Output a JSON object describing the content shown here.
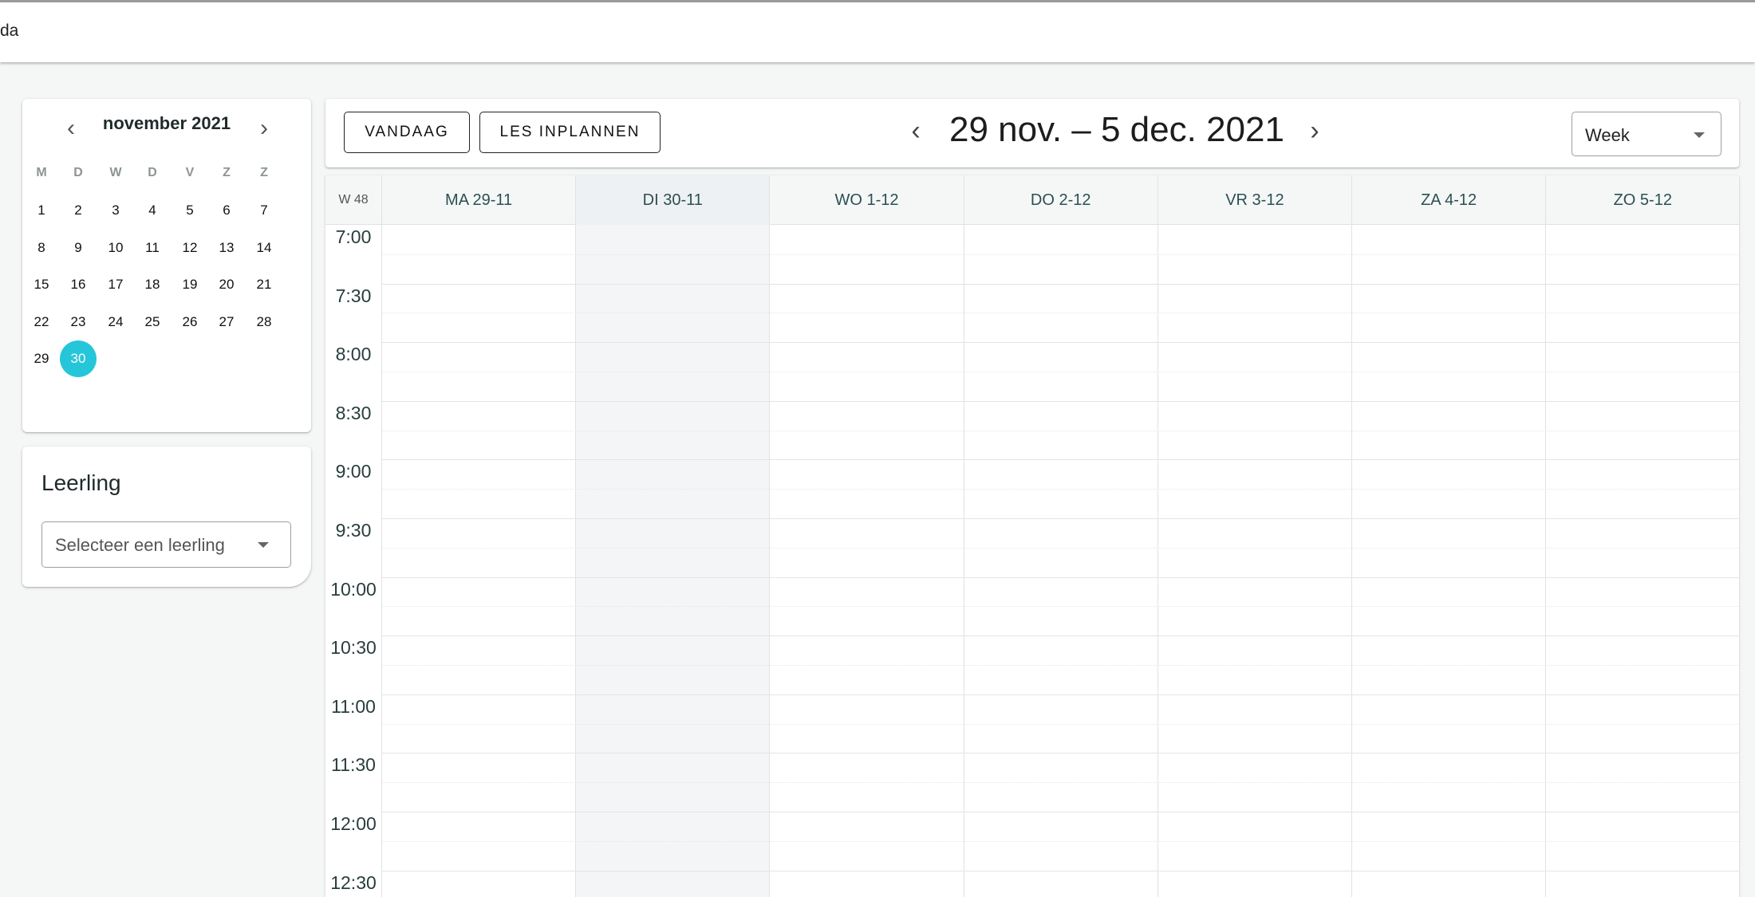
{
  "app": {
    "title": "da"
  },
  "mini_calendar": {
    "month_label": "november 2021",
    "prev_icon": "chevron-left-icon",
    "next_icon": "chevron-right-icon",
    "weekdays": [
      "M",
      "D",
      "W",
      "D",
      "V",
      "Z",
      "Z"
    ],
    "weeks": [
      [
        "1",
        "2",
        "3",
        "4",
        "5",
        "6",
        "7"
      ],
      [
        "8",
        "9",
        "10",
        "11",
        "12",
        "13",
        "14"
      ],
      [
        "15",
        "16",
        "17",
        "18",
        "19",
        "20",
        "21"
      ],
      [
        "22",
        "23",
        "24",
        "25",
        "26",
        "27",
        "28"
      ],
      [
        "29",
        "30"
      ]
    ],
    "selected_day": "30",
    "accent": "#26c6da"
  },
  "student_panel": {
    "label": "Leerling",
    "select_placeholder": "Selecteer een leerling"
  },
  "toolbar": {
    "today_label": "VANDAAG",
    "schedule_label": "LES INPLANNEN",
    "range_label": "29 nov. – 5 dec. 2021",
    "view_value": "Week"
  },
  "week_view": {
    "week_label": "W 48",
    "days": [
      "MA 29-11",
      "DI 30-11",
      "WO 1-12",
      "DO 2-12",
      "VR 3-12",
      "ZA 4-12",
      "ZO 5-12"
    ],
    "current_day_index": 1,
    "times": [
      "7:00",
      "7:30",
      "8:00",
      "8:30",
      "9:00",
      "9:30",
      "10:00",
      "10:30",
      "11:00",
      "11:30",
      "12:00",
      "12:30"
    ]
  }
}
